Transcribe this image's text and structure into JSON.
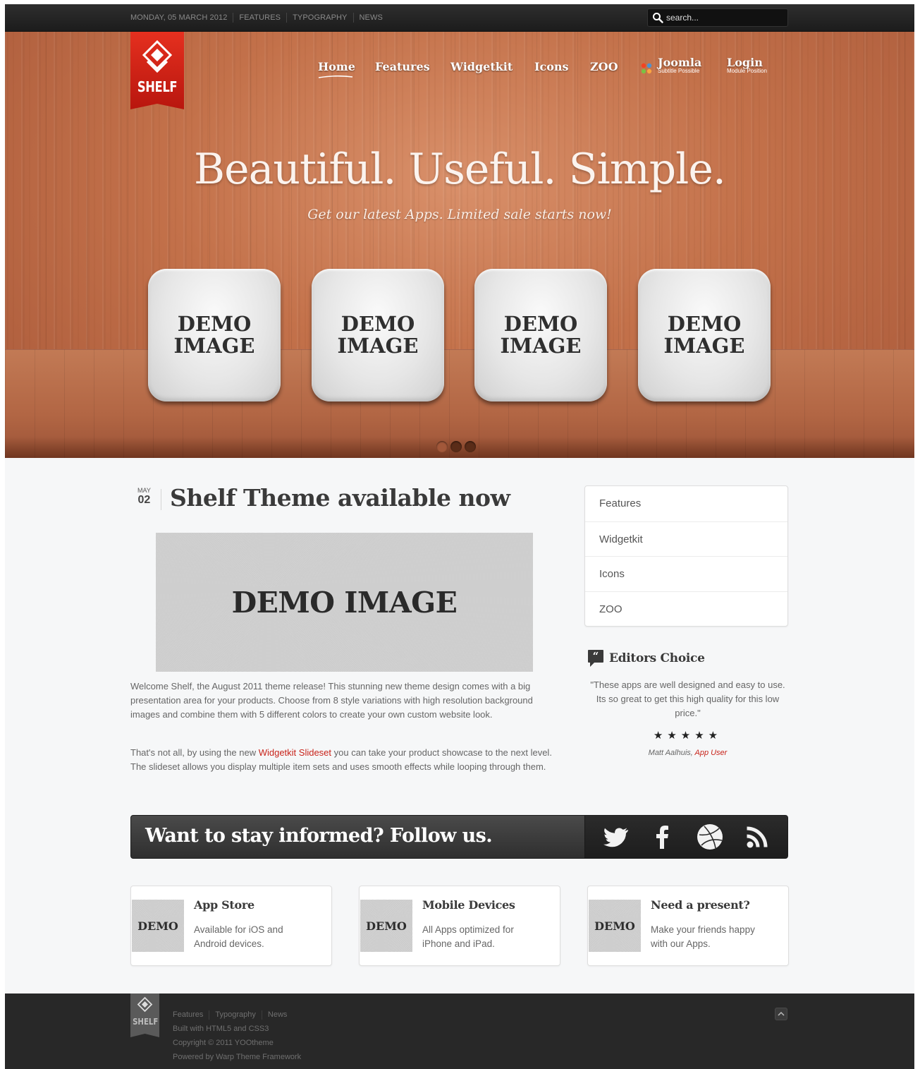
{
  "topbar": {
    "date": "MONDAY, 05 MARCH 2012",
    "links": [
      "FEATURES",
      "TYPOGRAPHY",
      "NEWS"
    ],
    "search_placeholder": "search..."
  },
  "logo": {
    "text": "SHELF"
  },
  "nav": {
    "home": "Home",
    "features": "Features",
    "widgetkit": "Widgetkit",
    "icons": "Icons",
    "zoo": "ZOO",
    "joomla": {
      "label": "Joomla",
      "subtitle": "Subtitle Possible"
    },
    "login": {
      "label": "Login",
      "subtitle": "Module Position"
    }
  },
  "hero": {
    "title": "Beautiful. Useful. Simple.",
    "subtitle": "Get our latest Apps. Limited sale starts now!",
    "tiles": [
      "DEMO IMAGE",
      "DEMO IMAGE",
      "DEMO IMAGE",
      "DEMO IMAGE"
    ],
    "slide_count": 3,
    "active_slide": 1
  },
  "article": {
    "date_month": "MAY",
    "date_day": "02",
    "title": "Shelf Theme available now",
    "image_text": "DEMO IMAGE",
    "para1": "Welcome Shelf, the August 2011 theme release! This stunning new theme design comes with a big presentation area for your products. Choose from 8 style variations with high resolution background images and combine them with 5 different colors to create your own custom website look.",
    "para2_before": "That's not all, by using the new ",
    "para2_link": "Widgetkit Slideset",
    "para2_after": " you can take your product showcase to the next level. The slideset allows you display multiple item sets and uses smooth effects while looping through them."
  },
  "sidebar": {
    "menu": [
      "Features",
      "Widgetkit",
      "Icons",
      "ZOO"
    ],
    "editors": {
      "title": "Editors Choice",
      "quote": "\"These apps are well designed and easy to use. Its so great to get this high quality for this low price.\"",
      "stars": "★★★★★",
      "rating": 5,
      "author_name": "Matt Aalhuis, ",
      "author_role": "App User"
    }
  },
  "follow": {
    "text": "Want to stay informed? Follow us.",
    "icons": [
      "twitter-icon",
      "facebook-icon",
      "dribbble-icon",
      "rss-icon"
    ]
  },
  "boxes": [
    {
      "thumb": "DEMO",
      "title": "App Store",
      "text": "Available for iOS and Android devices."
    },
    {
      "thumb": "DEMO",
      "title": "Mobile Devices",
      "text": "All Apps optimized for iPhone and iPad."
    },
    {
      "thumb": "DEMO",
      "title": "Need a present?",
      "text": "Make your friends happy with our Apps."
    }
  ],
  "footer": {
    "logo_text": "SHELF",
    "links": [
      "Features",
      "Typography",
      "News"
    ],
    "line1": "Built with HTML5 and CSS3",
    "line2": "Copyright © 2011 YOOtheme",
    "line3": "Powered by Warp Theme Framework"
  },
  "colors": {
    "accent_red": "#c8231a",
    "dark_bar": "#282828",
    "wood": "#c3714a"
  }
}
